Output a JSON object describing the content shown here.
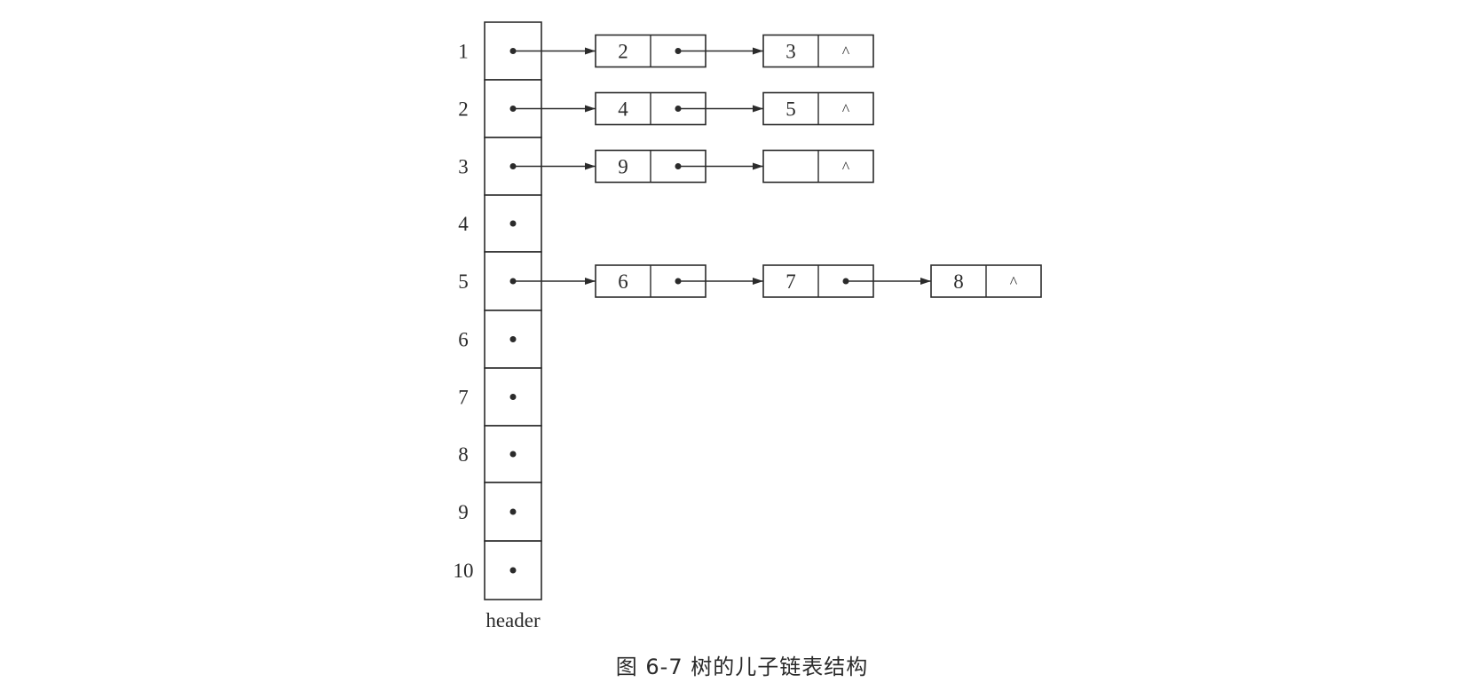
{
  "header": {
    "label": "header",
    "indices": [
      "1",
      "2",
      "3",
      "4",
      "5",
      "6",
      "7",
      "8",
      "9",
      "10"
    ]
  },
  "lists": [
    {
      "row": "1",
      "nodes": [
        "2",
        "3"
      ]
    },
    {
      "row": "2",
      "nodes": [
        "4",
        "5"
      ]
    },
    {
      "row": "3",
      "nodes": [
        "9",
        ""
      ]
    },
    {
      "row": "5",
      "nodes": [
        "6",
        "7",
        "8"
      ]
    }
  ],
  "null_symbol": "^",
  "caption": "图 6-7   树的儿子链表结构",
  "colors": {
    "ink": "#2b2b2b",
    "background": "#ffffff"
  }
}
